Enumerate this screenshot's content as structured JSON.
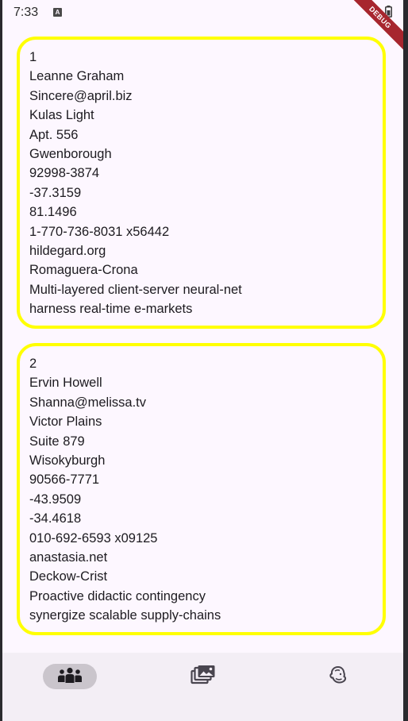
{
  "status_bar": {
    "time": "7:33",
    "notif_letter": "A"
  },
  "debug_banner": "DEBUG",
  "users": [
    {
      "id": "1",
      "name": "Leanne Graham",
      "email": "Sincere@april.biz",
      "street": "Kulas Light",
      "suite": "Apt. 556",
      "city": "Gwenborough",
      "zipcode": "92998-3874",
      "lat": "-37.3159",
      "lng": "81.1496",
      "phone": "1-770-736-8031 x56442",
      "website": "hildegard.org",
      "company_name": "Romaguera-Crona",
      "catch_phrase": "Multi-layered client-server neural-net",
      "bs": "harness real-time e-markets"
    },
    {
      "id": "2",
      "name": "Ervin Howell",
      "email": "Shanna@melissa.tv",
      "street": "Victor Plains",
      "suite": "Suite 879",
      "city": "Wisokyburgh",
      "zipcode": "90566-7771",
      "lat": "-43.9509",
      "lng": "-34.4618",
      "phone": "010-692-6593 x09125",
      "website": "anastasia.net",
      "company_name": "Deckow-Crist",
      "catch_phrase": "Proactive didactic contingency",
      "bs": "synergize scalable supply-chains"
    }
  ],
  "bottom_nav": {
    "items": [
      {
        "icon": "people-icon",
        "selected": true
      },
      {
        "icon": "photo-gallery-icon",
        "selected": false
      },
      {
        "icon": "mailchimp-icon",
        "selected": false
      }
    ]
  },
  "colors": {
    "card_border": "#ffff00",
    "background": "#fdf7ff",
    "nav_background": "#f3eef5",
    "nav_indicator": "#cac5cc",
    "debug_ribbon": "#a7262e"
  }
}
